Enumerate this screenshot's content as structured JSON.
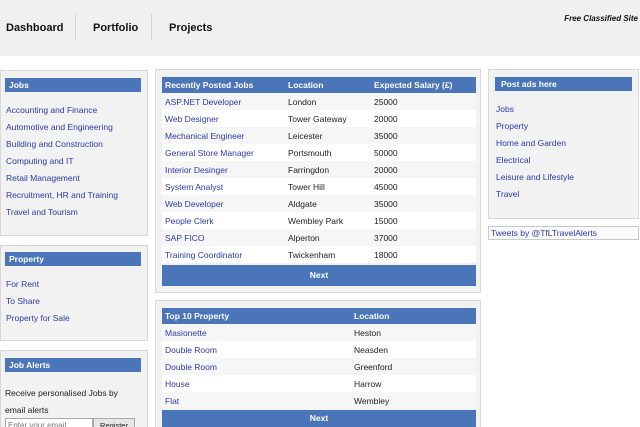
{
  "nav": {
    "items": [
      "Dashboard",
      "Portfolio",
      "Projects"
    ],
    "tagline": "Free Classified Site"
  },
  "jobs_panel": {
    "title": "Jobs",
    "items": [
      "Accounting and Finance",
      "Automotive and Engineering",
      "Building and Construction",
      "Computing and IT",
      "Retail Management",
      "Recruitment, HR and Training",
      "Travel and Tourism"
    ]
  },
  "property_panel": {
    "title": "Property",
    "items": [
      "For Rent",
      "To Share",
      "Property for Sale"
    ]
  },
  "job_alerts": {
    "title": "Job Alerts",
    "text": "Receive personalised Jobs by email alerts",
    "email_placeholder": "Enter your email",
    "register_label": "Register"
  },
  "recent_jobs": {
    "headers": [
      "Recently Posted Jobs",
      "Location",
      "Expected Salary (£)"
    ],
    "rows": [
      [
        "ASP.NET Developer",
        "London",
        "25000"
      ],
      [
        "Web Designer",
        "Tower Gateway",
        "20000"
      ],
      [
        "Mechanical Engineer",
        "Leicester",
        "35000"
      ],
      [
        "General Store Manager",
        "Portsmouth",
        "50000"
      ],
      [
        "Interior Desinger",
        "Farringdon",
        "20000"
      ],
      [
        "System Analyst",
        "Tower Hill",
        "45000"
      ],
      [
        "Web Developer",
        "Aldgate",
        "35000"
      ],
      [
        "People Clerk",
        "Wembley Park",
        "15000"
      ],
      [
        "SAP FICO",
        "Alperton",
        "37000"
      ],
      [
        "Training Coordinator",
        "Twickenham",
        "18000"
      ]
    ],
    "next_label": "Next"
  },
  "top_property": {
    "headers": [
      "Top 10 Property",
      "Location"
    ],
    "rows": [
      [
        "Masionette",
        "Heston"
      ],
      [
        "Double Room",
        "Neasden"
      ],
      [
        "Double Room",
        "Greenford"
      ],
      [
        "House",
        "Harrow"
      ],
      [
        "Flat",
        "Wembley"
      ]
    ],
    "next_label": "Next"
  },
  "post_ads": {
    "title": "Post ads here",
    "items": [
      "Jobs",
      "Property",
      "Home and Garden",
      "Electrical",
      "Leisure and Lifestyle",
      "Travel"
    ]
  },
  "tweets_label": "Tweets by @TfLTravelAlerts"
}
